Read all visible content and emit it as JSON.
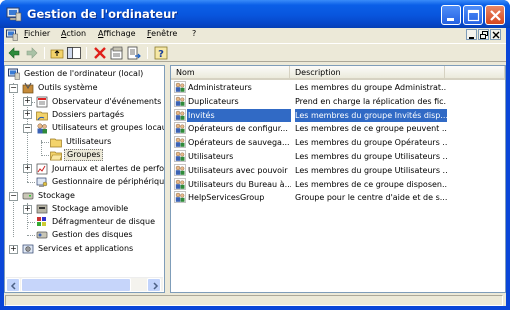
{
  "window": {
    "title": "Gestion de l'ordinateur"
  },
  "menu": [
    "Fichier",
    "Action",
    "Affichage",
    "Fenêtre",
    "?"
  ],
  "tree": {
    "root": "Gestion de l'ordinateur (local)",
    "system_tools": "Outils système",
    "event_viewer": "Observateur d'événements",
    "shared_folders": "Dossiers partagés",
    "local_users": "Utilisateurs et groupes locau",
    "users": "Utilisateurs",
    "groups": "Groupes",
    "logs": "Journaux et alertes de perfo",
    "device_manager": "Gestionnaire de périphérique",
    "storage": "Stockage",
    "removable": "Stockage amovible",
    "defrag": "Défragmenteur de disque",
    "disk_mgmt": "Gestion des disques",
    "services": "Services et applications"
  },
  "list": {
    "columns": [
      "Nom",
      "Description"
    ],
    "rows": [
      {
        "name": "Administrateurs",
        "desc": "Les membres du groupe Administrat..."
      },
      {
        "name": "Duplicateurs",
        "desc": "Prend en charge la réplication des fic..."
      },
      {
        "name": "Invités",
        "desc": "Les membres du groupe Invités disp..."
      },
      {
        "name": "Opérateurs de configur...",
        "desc": "Les membres de ce groupe peuvent ..."
      },
      {
        "name": "Opérateurs de sauvega...",
        "desc": "Les membres du groupe Opérateurs ..."
      },
      {
        "name": "Utilisateurs",
        "desc": "Les membres du groupe Utilisateurs ..."
      },
      {
        "name": "Utilisateurs avec pouvoir",
        "desc": "Les membres du groupe Utilisateurs ..."
      },
      {
        "name": "Utilisateurs du Bureau à...",
        "desc": "Les membres de ce groupe disposen..."
      },
      {
        "name": "HelpServicesGroup",
        "desc": "Groupe pour le centre d'aide et de s..."
      }
    ],
    "selected_index": 2
  },
  "colors": {
    "titlebar": "#0855dd",
    "selection": "#316ac5",
    "face": "#ece9d8"
  },
  "icons": [
    "computer-icon",
    "back-icon",
    "forward-icon",
    "up-folder-icon",
    "show-tree-icon",
    "delete-icon",
    "properties-icon",
    "export-icon",
    "help-icon",
    "group-icon",
    "folder-icon",
    "tools-icon",
    "disk-icon"
  ]
}
